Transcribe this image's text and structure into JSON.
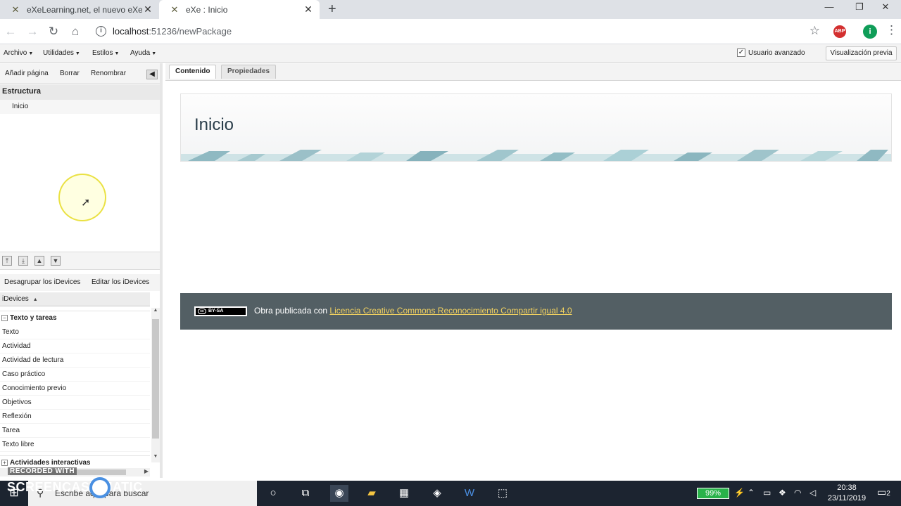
{
  "browser": {
    "tabs": [
      {
        "title": "eXeLearning.net, el nuevo eXeLe",
        "active": false
      },
      {
        "title": "eXe : Inicio",
        "active": true
      }
    ],
    "url_host": "localhost",
    "url_path": ":51236/newPackage",
    "profile_initial": "i",
    "abp_label": "ABP",
    "window_controls": [
      "—",
      "❐",
      "✕"
    ]
  },
  "menu": {
    "items": [
      "Archivo",
      "Utilidades",
      "Estilos",
      "Ayuda"
    ],
    "advanced_user_label": "Usuario avanzado",
    "advanced_user_checked": true,
    "preview_button": "Visualización previa"
  },
  "left_panel": {
    "toolbar": [
      "Añadir página",
      "Borrar",
      "Renombrar"
    ],
    "structure_title": "Estructura",
    "nodes": [
      "Inicio"
    ],
    "idevice_toolbar": [
      "Desagrupar los iDevices",
      "Editar los iDevices"
    ],
    "idevices_header": "iDevices",
    "categories": [
      {
        "name": "Texto y tareas",
        "expanded": true,
        "items": [
          "Texto",
          "Actividad",
          "Actividad de lectura",
          "Caso práctico",
          "Conocimiento previo",
          "Objetivos",
          "Reflexión",
          "Tarea",
          "Texto libre"
        ]
      },
      {
        "name": "Actividades interactivas",
        "expanded": false,
        "items": []
      }
    ]
  },
  "main": {
    "tabs": [
      "Contenido",
      "Propiedades"
    ],
    "active_tab": "Contenido",
    "page_title": "Inicio",
    "footer": {
      "badge": "BY-SA",
      "text": "Obra publicada con ",
      "link": "Licencia Creative Commons Reconocimiento Compartir igual 4.0"
    }
  },
  "taskbar": {
    "search_placeholder": "Escribe aquí para buscar",
    "battery": "99%",
    "time": "20:38",
    "date": "23/11/2019",
    "notifications": "2"
  },
  "watermark": {
    "recorded_with": "RECORDED WITH",
    "brand": "SCREENCAST  MATIC"
  },
  "colors": {
    "footer_bg": "#535f64",
    "link": "#f0d060",
    "title": "#2a3d4a",
    "battery": "#29b24a"
  }
}
